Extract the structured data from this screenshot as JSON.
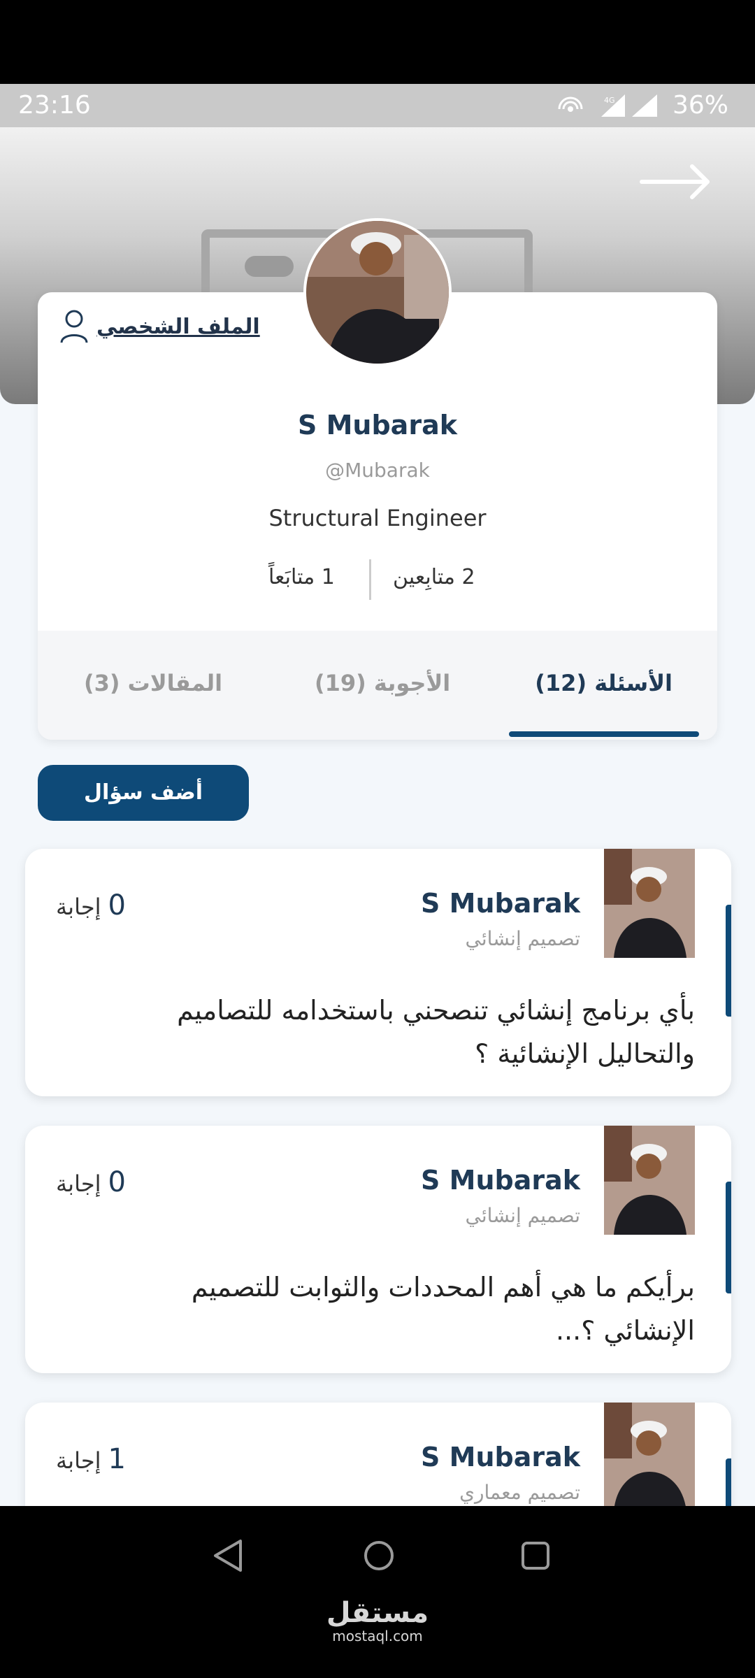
{
  "status_bar": {
    "time": "23:16",
    "battery": "36%",
    "network": "4G"
  },
  "header": {
    "profile_link": "الملف الشخصي"
  },
  "profile": {
    "name": "S Mubarak",
    "handle": "@Mubarak",
    "job_title": "Structural Engineer",
    "followers": "2 متابِعين",
    "following": "1 متابَعاً"
  },
  "tabs": {
    "questions": "الأسئلة (12)",
    "answers": "الأجوبة (19)",
    "articles": "المقالات (3)"
  },
  "add_question_label": "أضف سؤال",
  "questions": [
    {
      "author": "S Mubarak",
      "category": "تصميم إنشائي",
      "answers_count": "0",
      "answers_label": "إجابة",
      "text": "بأي برنامج إنشائي تنصحني باستخدامه للتصاميم والتحاليل الإنشائية ؟"
    },
    {
      "author": "S Mubarak",
      "category": "تصميم إنشائي",
      "answers_count": "0",
      "answers_label": "إجابة",
      "text": "برأيكم ما هي أهم المحددات والثوابت للتصميم الإنشائي ؟..."
    },
    {
      "author": "S Mubarak",
      "category": "تصميم معماري",
      "answers_count": "1",
      "answers_label": "إجابة",
      "text": ""
    }
  ],
  "watermark": {
    "ar": "مستقل",
    "en": "mostaql.com"
  },
  "colors": {
    "primary": "#0e4a78",
    "text_dark": "#1f3a56",
    "muted": "#9a9a9a"
  },
  "icons": [
    "wifi-hotspot-icon",
    "signal-icon",
    "back-arrow-icon",
    "user-icon",
    "nav-back-icon",
    "nav-home-icon",
    "nav-recents-icon"
  ]
}
